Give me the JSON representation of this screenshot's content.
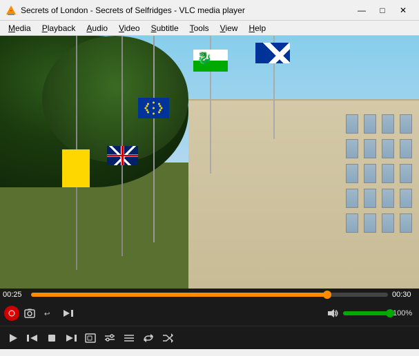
{
  "titleBar": {
    "icon": "vlc-icon",
    "title": "Secrets of London - Secrets of Selfridges - VLC media player",
    "minimizeLabel": "—",
    "maximizeLabel": "□",
    "closeLabel": "✕"
  },
  "menuBar": {
    "items": [
      {
        "id": "media",
        "label": "Media",
        "underline": "M"
      },
      {
        "id": "playback",
        "label": "Playback",
        "underline": "P"
      },
      {
        "id": "audio",
        "label": "Audio",
        "underline": "A"
      },
      {
        "id": "video",
        "label": "Video",
        "underline": "V"
      },
      {
        "id": "subtitle",
        "label": "Subtitle",
        "underline": "S"
      },
      {
        "id": "tools",
        "label": "Tools",
        "underline": "T"
      },
      {
        "id": "view",
        "label": "View",
        "underline": "V"
      },
      {
        "id": "help",
        "label": "Help",
        "underline": "H"
      }
    ]
  },
  "player": {
    "currentTime": "00:25",
    "totalTime": "00:30",
    "progressPercent": 83.3,
    "volumePercent": 100,
    "volumeLabel": "100%"
  },
  "controls": {
    "recordLabel": "⏺",
    "snapshotLabel": "📷",
    "loopABLabel": "↩",
    "frameNextLabel": "▶|",
    "playLabel": "▶",
    "prevLabel": "⏮",
    "stopLabel": "⏹",
    "nextLabel": "⏭",
    "fullscreenLabel": "⛶",
    "extSettings": "⚙",
    "playlist": "☰",
    "repeatLabel": "🔁",
    "randomLabel": "🔀",
    "volumeLabel": "🔊"
  }
}
